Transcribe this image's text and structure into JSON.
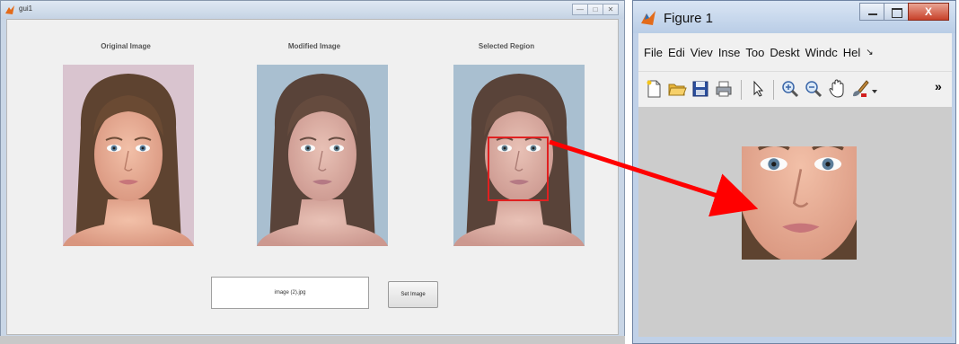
{
  "gui_window": {
    "title": "gui1",
    "controls": {
      "minimize": "—",
      "maximize": "□",
      "close": "✕"
    },
    "panels": [
      {
        "caption": "Original Image"
      },
      {
        "caption": "Modified Image"
      },
      {
        "caption": "Selected Region"
      }
    ],
    "filename_field": {
      "value": "image (2).jpg"
    },
    "set_image_button": {
      "label": "Set Image"
    }
  },
  "figure_window": {
    "title": "Figure 1",
    "controls": {
      "close": "X"
    },
    "menu": [
      "File",
      "Edi",
      "Viev",
      "Inse",
      "Too",
      "Deskt",
      "Windc",
      "Hel"
    ],
    "menu_overflow": "↘",
    "toolbar_icons": [
      "new-file-icon",
      "open-folder-icon",
      "save-icon",
      "print-icon",
      "pointer-icon",
      "zoom-in-icon",
      "zoom-out-icon",
      "pan-hand-icon",
      "brush-icon",
      "dropdown-arrow-icon",
      "more-icon"
    ],
    "toolbar_more": "»"
  },
  "colors": {
    "selection_rect": "#e02020",
    "arrow": "#ff0000"
  }
}
